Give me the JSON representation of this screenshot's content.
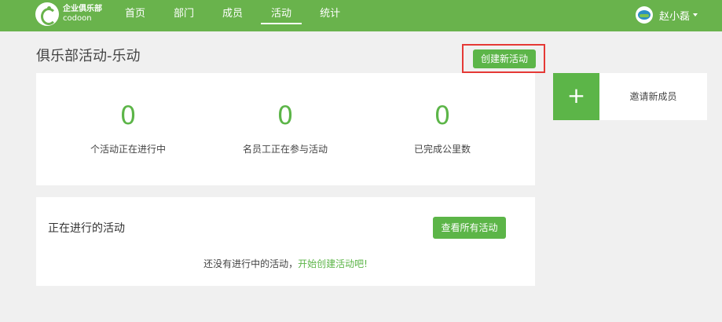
{
  "brand": {
    "line1": "企业俱乐部",
    "line2": "codoon"
  },
  "nav": {
    "items": [
      {
        "label": "首页"
      },
      {
        "label": "部门"
      },
      {
        "label": "成员"
      },
      {
        "label": "活动",
        "active": true
      },
      {
        "label": "统计"
      }
    ]
  },
  "user": {
    "name": "赵小磊"
  },
  "page": {
    "title": "俱乐部活动-乐动",
    "create_label": "创建新活动"
  },
  "stats": [
    {
      "value": "0",
      "label": "个活动正在进行中"
    },
    {
      "value": "0",
      "label": "名员工正在参与活动"
    },
    {
      "value": "0",
      "label": "已完成公里数"
    }
  ],
  "invite": {
    "icon": "+",
    "label": "邀请新成员"
  },
  "ongoing": {
    "title": "正在进行的活动",
    "view_all_label": "查看所有活动",
    "empty_prefix": "还没有进行中的活动，",
    "empty_link": "开始创建活动吧!"
  },
  "colors": {
    "accent": "#5cb548",
    "topbar": "#69b34c",
    "highlight_border": "#e53935"
  }
}
